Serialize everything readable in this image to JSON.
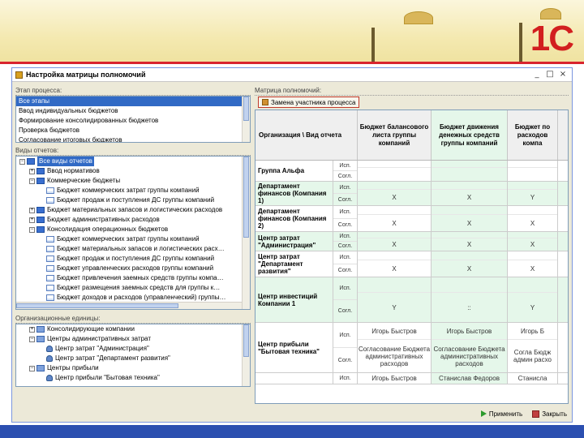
{
  "window": {
    "title": "Настройка матрицы полномочий",
    "min": "_",
    "max": "□",
    "close": "×"
  },
  "left": {
    "steps_label": "Этап процесса:",
    "steps": [
      "Все этапы",
      "Ввод индивидуальных бюджетов",
      "Формирование консолидированных бюджетов",
      "Проверка бюджетов",
      "Согласование итоговых бюджетов"
    ],
    "reports_label": "Виды отчетов:",
    "reports": [
      {
        "label": "Все виды отчетов",
        "indent": 0,
        "toggle": "⊟",
        "icon": "folder",
        "selected": true
      },
      {
        "label": "Ввод нормативов",
        "indent": 1,
        "toggle": "⊞",
        "icon": "folder"
      },
      {
        "label": "Коммерческие бюджеты",
        "indent": 1,
        "toggle": "⊟",
        "icon": "folder"
      },
      {
        "label": "Бюджет коммерческих затрат группы компаний",
        "indent": 2,
        "toggle": "",
        "icon": "doc"
      },
      {
        "label": "Бюджет продаж и поступления ДС группы компаний",
        "indent": 2,
        "toggle": "",
        "icon": "doc"
      },
      {
        "label": "Бюджет материальных запасов и логистических расходов",
        "indent": 1,
        "toggle": "⊞",
        "icon": "folder"
      },
      {
        "label": "Бюджет административных расходов",
        "indent": 1,
        "toggle": "⊞",
        "icon": "folder"
      },
      {
        "label": "Консолидация операционных бюджетов",
        "indent": 1,
        "toggle": "⊟",
        "icon": "folder"
      },
      {
        "label": "Бюджет коммерческих затрат группы компаний",
        "indent": 2,
        "toggle": "",
        "icon": "doc"
      },
      {
        "label": "Бюджет материальных запасов и логистических расх…",
        "indent": 2,
        "toggle": "",
        "icon": "doc"
      },
      {
        "label": "Бюджет продаж и поступления ДС группы компаний",
        "indent": 2,
        "toggle": "",
        "icon": "doc"
      },
      {
        "label": "Бюджет управленческих расходов группы компаний",
        "indent": 2,
        "toggle": "",
        "icon": "doc"
      },
      {
        "label": "Бюджет привлечения заемных средств группы компа…",
        "indent": 2,
        "toggle": "",
        "icon": "doc"
      },
      {
        "label": "Бюджет размещения заемных средств для группы к…",
        "indent": 2,
        "toggle": "",
        "icon": "doc"
      },
      {
        "label": "Бюджет доходов и расходов (управленческий) группы…",
        "indent": 2,
        "toggle": "",
        "icon": "doc"
      }
    ],
    "units_label": "Организационные единицы:",
    "units": [
      {
        "label": "Консолидирующие компании",
        "indent": 1,
        "toggle": "⊞",
        "icon": "grp"
      },
      {
        "label": "Центры административных затрат",
        "indent": 1,
        "toggle": "⊟",
        "icon": "grp"
      },
      {
        "label": "Центр затрат \"Администрация\"",
        "indent": 2,
        "toggle": "",
        "icon": "pers"
      },
      {
        "label": "Центр затрат \"Департамент развития\"",
        "indent": 2,
        "toggle": "",
        "icon": "pers"
      },
      {
        "label": "Центры прибыли",
        "indent": 1,
        "toggle": "⊟",
        "icon": "grp"
      },
      {
        "label": "Центр прибыли \"Бытовая техника\"",
        "indent": 2,
        "toggle": "",
        "icon": "pers"
      }
    ]
  },
  "right": {
    "matrix_label": "Матрица полномочий:",
    "replace_btn": "Замена участника процесса",
    "header": [
      "Организация \\ Вид отчета",
      "Бюджет балансового листа группы компаний",
      "Бюджет движения денежных средств группы компаний",
      "Бюджет по расходов компа"
    ],
    "rows": [
      {
        "org": "Группа Альфа",
        "a": "Исп.",
        "b": "Согл.",
        "v": [
          "",
          "",
          "",
          "",
          "",
          ""
        ],
        "green": false,
        "h": 26
      },
      {
        "org": "Департамент финансов (Компания 1)",
        "a": "Исп.",
        "b": "Согл.",
        "v": [
          "",
          "X",
          "",
          "X",
          "",
          "Y"
        ],
        "green": true,
        "h": 30
      },
      {
        "org": "Департамент финансов (Компания 2)",
        "a": "Исп.",
        "b": "Согл.",
        "v": [
          "",
          "X",
          "",
          "X",
          "",
          "X"
        ],
        "green": false,
        "h": 32
      },
      {
        "org": "Центр затрат \"Администрация\"",
        "a": "Исп.",
        "b": "Согл.",
        "v": [
          "",
          "X",
          "",
          "X",
          "",
          "X"
        ],
        "green": true,
        "h": 24
      },
      {
        "org": "Центр затрат \"Департамент развития\"",
        "a": "Исп.",
        "b": "Согл.",
        "v": [
          "",
          "X",
          "",
          "X",
          "",
          "X"
        ],
        "green": false,
        "h": 32
      },
      {
        "org": "Центр инвестиций Компании 1",
        "a": "Исп.",
        "b": "Согл.",
        "v": [
          "",
          "Y",
          "",
          "::",
          "",
          "Y"
        ],
        "green": true,
        "h": 56
      },
      {
        "org": "Центр прибыли \"Бытовая техника\"",
        "a": "Исп.",
        "b": "Согл.",
        "v": [
          "Игорь Быстров",
          "Согласование Бюджета административных расходов",
          "Игорь Быстров",
          "Согласование Бюджета административных расходов",
          "Игорь Б",
          "Согла Бюдж админ расхо"
        ],
        "green": false,
        "h": 62
      },
      {
        "org": "",
        "a": "Исп.",
        "b": "",
        "v": [
          "Игорь Быстров",
          "",
          "Станислав Федоров",
          "",
          "Станисла",
          ""
        ],
        "green": false,
        "h": 14
      }
    ]
  },
  "buttons": {
    "apply": "Применить",
    "close": "Закрыть"
  },
  "logo": {
    "text": "1С"
  },
  "colors": {
    "accent": "#d8242e",
    "selection": "#316ac5",
    "green_cell": "#e5f7ea"
  }
}
